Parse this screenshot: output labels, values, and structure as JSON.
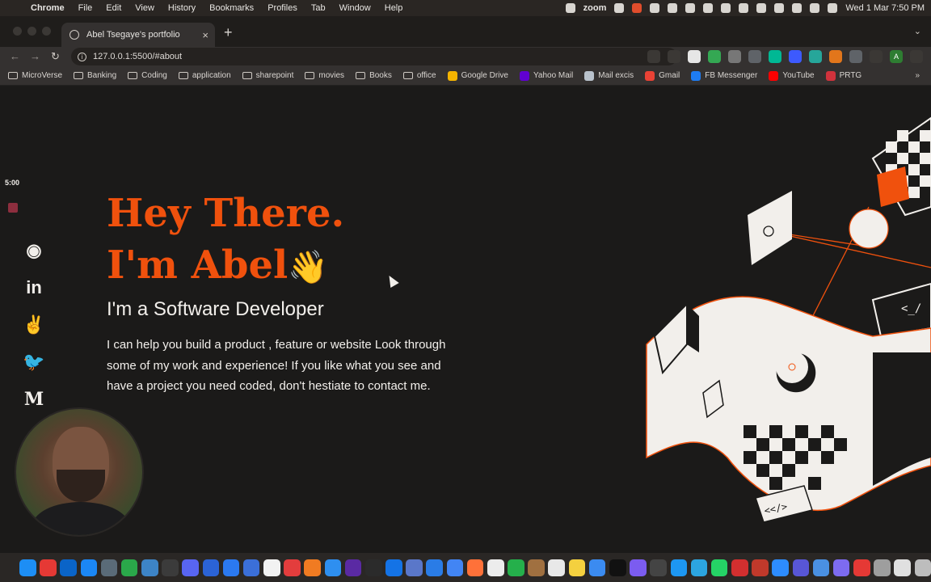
{
  "menubar": {
    "app": "Chrome",
    "items": [
      "File",
      "Edit",
      "View",
      "History",
      "Bookmarks",
      "Profiles",
      "Tab",
      "Window",
      "Help"
    ],
    "zoom_label": "zoom",
    "clock": "Wed 1 Mar  7:50 PM"
  },
  "browser": {
    "tab_title": "Abel Tsegaye's portfolio",
    "url": "127.0.0.1:5500/#about",
    "profile_initial": "A"
  },
  "bookmarks": [
    {
      "label": "MicroVerse",
      "kind": "folder"
    },
    {
      "label": "Banking",
      "kind": "folder"
    },
    {
      "label": "Coding",
      "kind": "folder"
    },
    {
      "label": "application",
      "kind": "folder"
    },
    {
      "label": "sharepoint",
      "kind": "folder"
    },
    {
      "label": "movies",
      "kind": "folder"
    },
    {
      "label": "Books",
      "kind": "folder"
    },
    {
      "label": "office",
      "kind": "folder"
    },
    {
      "label": "Google Drive",
      "kind": "site",
      "color": "#f5b400"
    },
    {
      "label": "Yahoo Mail",
      "kind": "site",
      "color": "#6001d2"
    },
    {
      "label": "Mail excis",
      "kind": "site",
      "color": "#b9c2cc"
    },
    {
      "label": "Gmail",
      "kind": "site",
      "color": "#e94235"
    },
    {
      "label": "FB Messenger",
      "kind": "site",
      "color": "#1e7cf2"
    },
    {
      "label": "YouTube",
      "kind": "site",
      "color": "#ff0000"
    },
    {
      "label": "PRTG",
      "kind": "site",
      "color": "#d0323c"
    }
  ],
  "recording": {
    "timer": "5:00"
  },
  "socials": [
    {
      "icon": "github-icon",
      "glyph": "◉"
    },
    {
      "icon": "linkedin-icon",
      "glyph": "in"
    },
    {
      "icon": "angellist-icon",
      "glyph": "✌"
    },
    {
      "icon": "twitter-icon",
      "glyph": "🐦"
    },
    {
      "icon": "medium-icon",
      "glyph": "M"
    }
  ],
  "hero": {
    "line1": "Hey There.",
    "line2": "I'm Abel",
    "wave": "👋",
    "subtitle": "I'm a Software Developer",
    "description": "I can help you build a product , feature or website Look through some of my work and experience! If you like what you see and have a project you need coded, don't hestiate to contact me."
  },
  "art": {
    "code_tag_1": "<</>",
    "code_tag_2": "<_/"
  },
  "colors": {
    "accent": "#f0510d",
    "page_bg": "#1b1a19",
    "text": "#f2efeb"
  },
  "dock_colors": [
    "#1d8ef5",
    "#e53935",
    "#0a64c8",
    "#1b87f5",
    "#5a6b78",
    "#2aa84a",
    "#3d84c6",
    "#3b3b3b",
    "#5865f2",
    "#2b63d6",
    "#2b79f0",
    "#3b6fd8",
    "#f2f2f2",
    "#e33d3d",
    "#f07b22",
    "#2e8ff0",
    "#5a2aa3",
    "#2b2b2b",
    "#1473e6",
    "#5a77c9",
    "#2a7ce6",
    "#4285f4",
    "#ff7139",
    "#ececec",
    "#25b04b",
    "#a07040",
    "#e8e8e8",
    "#f4d03f",
    "#3b8bf0",
    "#111111",
    "#7b5cf0",
    "#444444",
    "#1d97f2",
    "#2ca5e0",
    "#25d366",
    "#d32f2f",
    "#c0392b",
    "#2d8cff",
    "#5856d6",
    "#4a90e2",
    "#7d6bf0",
    "#e53935",
    "#9e9e9e",
    "#e0e0e0",
    "#bdbdbd"
  ]
}
